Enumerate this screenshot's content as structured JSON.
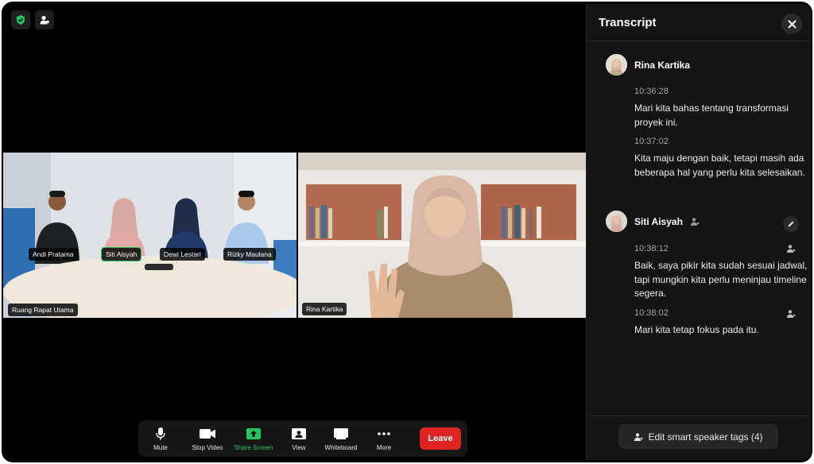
{
  "colors": {
    "accent_green": "#22c55e",
    "leave_red": "#e02424",
    "panel_bg": "#141414"
  },
  "top_icons": [
    "shield-check-icon",
    "participant-icon"
  ],
  "tiles": {
    "room": {
      "label": "Ruang Rapat Utama",
      "participants": [
        "Andi Pratama",
        "Siti Aisyah",
        "Dewi Lestari",
        "Rizky Maulana"
      ],
      "active_speaker": "Siti Aisyah"
    },
    "rina": {
      "label": "Rina Kartika"
    }
  },
  "toolbar": {
    "mute": "Mute",
    "stop_video": "Stop Video",
    "share_screen": "Share Screen",
    "view": "View",
    "whiteboard": "Whiteboard",
    "more": "More",
    "leave": "Leave"
  },
  "transcript": {
    "title": "Transcript",
    "groups": [
      {
        "speaker": "Rina Kartika",
        "entries": [
          {
            "time": "10:36:28",
            "text": "Mari kita bahas tentang transformasi proyek ini."
          },
          {
            "time": "10:37:02",
            "text": "Kita maju dengan baik, tetapi masih ada beberapa hal yang perlu kita selesaikan."
          }
        ]
      },
      {
        "speaker": "Siti Aisyah",
        "entries": [
          {
            "time": "10:38:12",
            "text": "Baik, saya pikir kita sudah sesuai jadwal, tapi mungkin kita perlu meninjau timeline segera."
          },
          {
            "time": "10:38:02",
            "text": "Mari kita tetap fokus pada itu."
          }
        ]
      }
    ],
    "edit_tags_label": "Edit smart speaker tags (4)"
  }
}
